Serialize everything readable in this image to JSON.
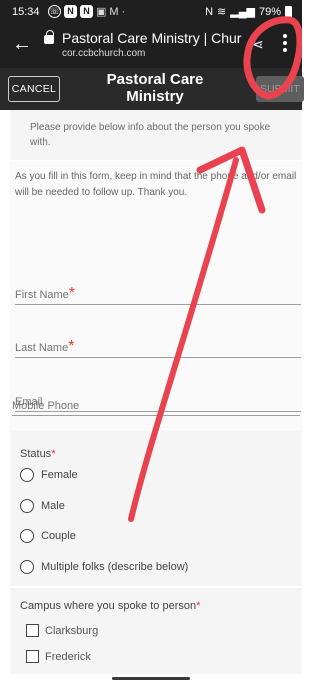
{
  "status_bar": {
    "time": "15:34",
    "battery": "79%"
  },
  "browser": {
    "page_title": "Pastoral Care Ministry | Church ...",
    "domain": "cor.ccbchurch.com"
  },
  "app_bar": {
    "cancel_label": "CANCEL",
    "title": "Pastoral Care Ministry",
    "submit_label": "SUBMIT"
  },
  "form": {
    "intro": "Please provide below info about the person you spoke with.",
    "note": "As you fill in this form, keep in mind that the phone and/or email will be needed to follow up.  Thank you.",
    "first_name": "First Name",
    "last_name": "Last Name",
    "email": "Email",
    "mobile_phone": "Mobile Phone",
    "required_mark": "*",
    "status_label": "Status",
    "status_options": [
      "Female",
      "Male",
      "Couple",
      "Multiple folks (describe below)"
    ],
    "campus_label": "Campus where you spoke to person",
    "campus_options": [
      "Clarksburg",
      "Frederick"
    ]
  },
  "colors": {
    "required": "#e53935",
    "annotation": "#e8434f",
    "app_bar": "#2a2a2a"
  }
}
